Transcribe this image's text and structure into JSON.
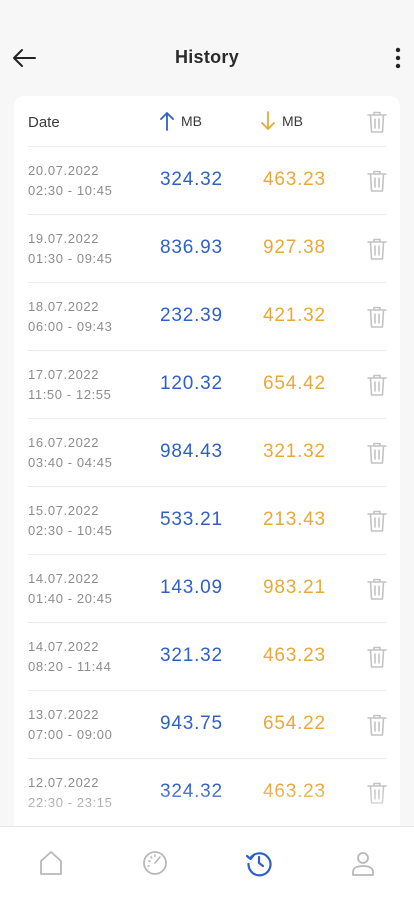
{
  "header": {
    "title": "History",
    "back_icon": "arrow-left-icon",
    "more_icon": "more-vertical-icon"
  },
  "table": {
    "headers": {
      "date": "Date",
      "upload_mb": "MB",
      "download_mb": "MB"
    },
    "colors": {
      "upload": "#2f5fc9",
      "download": "#e8a93a",
      "icon": "#c4c4c4"
    },
    "rows": [
      {
        "date": "20.07.2022",
        "time": "02:30 - 10:45",
        "upload": "324.32",
        "download": "463.23"
      },
      {
        "date": "19.07.2022",
        "time": "01:30 - 09:45",
        "upload": "836.93",
        "download": "927.38"
      },
      {
        "date": "18.07.2022",
        "time": "06:00 - 09:43",
        "upload": "232.39",
        "download": "421.32"
      },
      {
        "date": "17.07.2022",
        "time": "11:50 - 12:55",
        "upload": "120.32",
        "download": "654.42"
      },
      {
        "date": "16.07.2022",
        "time": "03:40 - 04:45",
        "upload": "984.43",
        "download": "321.32"
      },
      {
        "date": "15.07.2022",
        "time": "02:30 - 10:45",
        "upload": "533.21",
        "download": "213.43"
      },
      {
        "date": "14.07.2022",
        "time": "01:40 - 20:45",
        "upload": "143.09",
        "download": "983.21"
      },
      {
        "date": "14.07.2022",
        "time": "08:20 - 11:44",
        "upload": "321.32",
        "download": "463.23"
      },
      {
        "date": "13.07.2022",
        "time": "07:00 - 09:00",
        "upload": "943.75",
        "download": "654.22"
      },
      {
        "date": "12.07.2022",
        "time": "22:30 - 23:15",
        "upload": "324.32",
        "download": "463.23"
      }
    ]
  },
  "tabbar": {
    "active_color": "#2f5fc9",
    "inactive_color": "#b8b8b8",
    "tabs": [
      {
        "icon": "home-icon",
        "active": false
      },
      {
        "icon": "speedometer-icon",
        "active": false
      },
      {
        "icon": "history-icon",
        "active": true
      },
      {
        "icon": "profile-icon",
        "active": false
      }
    ]
  }
}
